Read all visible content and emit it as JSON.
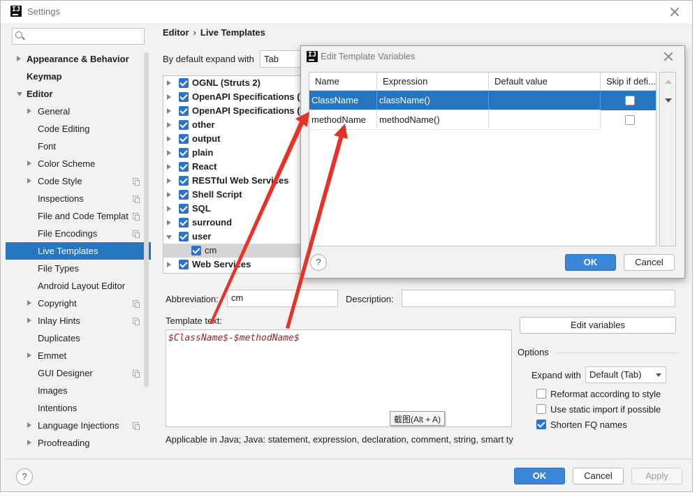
{
  "window": {
    "title": "Settings"
  },
  "search": {
    "placeholder": "Q-",
    "value": ""
  },
  "sidebar": {
    "items": [
      {
        "label": "Appearance & Behavior",
        "level": 0,
        "arrow": "right",
        "bold": true,
        "copy": false,
        "selected": false
      },
      {
        "label": "Keymap",
        "level": 0,
        "arrow": "none",
        "bold": true,
        "copy": false,
        "selected": false
      },
      {
        "label": "Editor",
        "level": 0,
        "arrow": "down",
        "bold": true,
        "copy": false,
        "selected": false
      },
      {
        "label": "General",
        "level": 1,
        "arrow": "right",
        "bold": false,
        "copy": false,
        "selected": false
      },
      {
        "label": "Code Editing",
        "level": 1,
        "arrow": "none",
        "bold": false,
        "copy": false,
        "selected": false
      },
      {
        "label": "Font",
        "level": 1,
        "arrow": "none",
        "bold": false,
        "copy": false,
        "selected": false
      },
      {
        "label": "Color Scheme",
        "level": 1,
        "arrow": "right",
        "bold": false,
        "copy": false,
        "selected": false
      },
      {
        "label": "Code Style",
        "level": 1,
        "arrow": "right",
        "bold": false,
        "copy": true,
        "selected": false
      },
      {
        "label": "Inspections",
        "level": 1,
        "arrow": "none",
        "bold": false,
        "copy": true,
        "selected": false
      },
      {
        "label": "File and Code Templat",
        "level": 1,
        "arrow": "none",
        "bold": false,
        "copy": true,
        "selected": false
      },
      {
        "label": "File Encodings",
        "level": 1,
        "arrow": "none",
        "bold": false,
        "copy": true,
        "selected": false
      },
      {
        "label": "Live Templates",
        "level": 1,
        "arrow": "none",
        "bold": false,
        "copy": false,
        "selected": true
      },
      {
        "label": "File Types",
        "level": 1,
        "arrow": "none",
        "bold": false,
        "copy": false,
        "selected": false
      },
      {
        "label": "Android Layout Editor",
        "level": 1,
        "arrow": "none",
        "bold": false,
        "copy": false,
        "selected": false
      },
      {
        "label": "Copyright",
        "level": 1,
        "arrow": "right",
        "bold": false,
        "copy": true,
        "selected": false
      },
      {
        "label": "Inlay Hints",
        "level": 1,
        "arrow": "right",
        "bold": false,
        "copy": true,
        "selected": false
      },
      {
        "label": "Duplicates",
        "level": 1,
        "arrow": "none",
        "bold": false,
        "copy": false,
        "selected": false
      },
      {
        "label": "Emmet",
        "level": 1,
        "arrow": "right",
        "bold": false,
        "copy": false,
        "selected": false
      },
      {
        "label": "GUI Designer",
        "level": 1,
        "arrow": "none",
        "bold": false,
        "copy": true,
        "selected": false
      },
      {
        "label": "Images",
        "level": 1,
        "arrow": "none",
        "bold": false,
        "copy": false,
        "selected": false
      },
      {
        "label": "Intentions",
        "level": 1,
        "arrow": "none",
        "bold": false,
        "copy": false,
        "selected": false
      },
      {
        "label": "Language Injections",
        "level": 1,
        "arrow": "right",
        "bold": false,
        "copy": true,
        "selected": false
      },
      {
        "label": "Proofreading",
        "level": 1,
        "arrow": "right",
        "bold": false,
        "copy": false,
        "selected": false
      }
    ]
  },
  "breadcrumb": {
    "parent": "Editor",
    "separator": "›",
    "current": "Live Templates"
  },
  "expand": {
    "label": "By default expand with",
    "value": "Tab"
  },
  "template_groups": [
    {
      "label": "OGNL (Struts 2)",
      "checked": true,
      "expanded": false,
      "child": false
    },
    {
      "label": "OpenAPI Specifications (.",
      "checked": true,
      "expanded": false,
      "child": false
    },
    {
      "label": "OpenAPI Specifications (.",
      "checked": true,
      "expanded": false,
      "child": false
    },
    {
      "label": "other",
      "checked": true,
      "expanded": false,
      "child": false
    },
    {
      "label": "output",
      "checked": true,
      "expanded": false,
      "child": false
    },
    {
      "label": "plain",
      "checked": true,
      "expanded": false,
      "child": false
    },
    {
      "label": "React",
      "checked": true,
      "expanded": false,
      "child": false
    },
    {
      "label": "RESTful Web Services",
      "checked": true,
      "expanded": false,
      "child": false
    },
    {
      "label": "Shell Script",
      "checked": true,
      "expanded": false,
      "child": false
    },
    {
      "label": "SQL",
      "checked": true,
      "expanded": false,
      "child": false
    },
    {
      "label": "surround",
      "checked": true,
      "expanded": false,
      "child": false
    },
    {
      "label": "user",
      "checked": true,
      "expanded": true,
      "child": false
    },
    {
      "label": "cm",
      "checked": true,
      "expanded": false,
      "child": true
    },
    {
      "label": "Web Services",
      "checked": true,
      "expanded": false,
      "child": false
    }
  ],
  "form": {
    "abbreviation_label": "Abbreviation:",
    "abbreviation_value": "cm",
    "description_label": "Description:",
    "description_value": "",
    "template_text_label": "Template text:",
    "template_text": "$ClassName$-$methodName$",
    "edit_variables": "Edit variables",
    "applicable": "Applicable in Java; Java: statement, expression, declaration, comment, string, smart ty"
  },
  "options": {
    "title": "Options",
    "expand_label": "Expand with",
    "expand_value": "Default (Tab)",
    "checkboxes": [
      {
        "label": "Reformat according to style",
        "checked": false
      },
      {
        "label": "Use static import if possible",
        "checked": false
      },
      {
        "label": "Shorten FQ names",
        "checked": true
      }
    ]
  },
  "tooltip": "截图(Alt + A)",
  "footer": {
    "help": "?",
    "ok": "OK",
    "cancel": "Cancel",
    "apply": "Apply"
  },
  "dialog": {
    "title": "Edit Template Variables",
    "columns": [
      "Name",
      "Expression",
      "Default value",
      "Skip if defi..."
    ],
    "rows": [
      {
        "name": "ClassName",
        "expression": "className()",
        "default": "",
        "skip": false,
        "selected": true
      },
      {
        "name": "methodName",
        "expression": "methodName()",
        "default": "",
        "skip": false,
        "selected": false
      }
    ],
    "help": "?",
    "ok": "OK",
    "cancel": "Cancel"
  },
  "colors": {
    "selection": "#2675bf",
    "accent_button": "#3c86d8",
    "template_text": "#9b1f1f",
    "annotation_arrow": "#e5332a"
  }
}
